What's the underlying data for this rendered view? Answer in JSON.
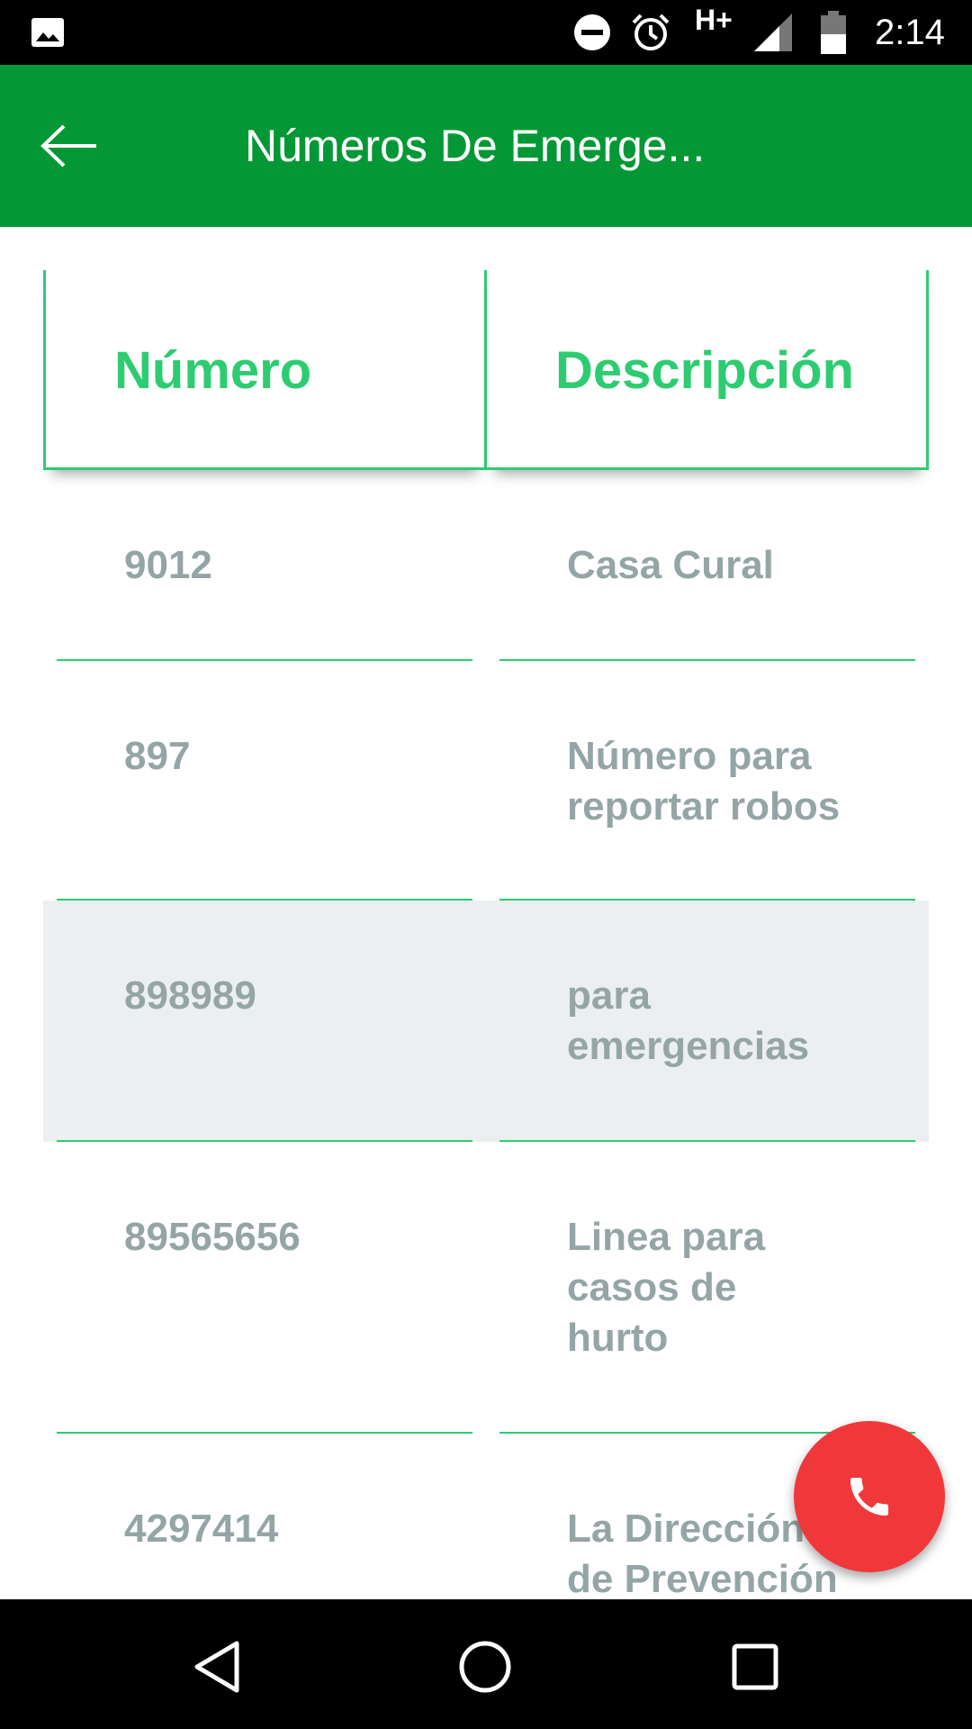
{
  "status_bar": {
    "time": "2:14",
    "network": "H+",
    "icons": [
      "gallery-icon",
      "do-not-disturb-icon",
      "alarm-icon",
      "signal-icon",
      "battery-icon"
    ]
  },
  "app_bar": {
    "title": "Números De Emerge...",
    "back_icon": "arrow-left-icon",
    "color": "#039835"
  },
  "table": {
    "headers": [
      "Número",
      "Descripción"
    ],
    "accent_color": "#2ecc71",
    "text_color": "#95a5a6",
    "rows": [
      {
        "numero": "9012",
        "descripcion": "Casa Cural"
      },
      {
        "numero": "897",
        "descripcion": "Número para reportar robos"
      },
      {
        "numero": "898989",
        "descripcion": "para emergencias",
        "highlighted": true
      },
      {
        "numero": "89565656",
        "descripcion": "Linea para casos de hurto"
      },
      {
        "numero": "4297414",
        "descripcion": "La Dirección de Prevención"
      }
    ]
  },
  "fab": {
    "icon": "phone-icon",
    "color": "#f0383a"
  },
  "nav_bar": {
    "icons": [
      "back-triangle-icon",
      "home-circle-icon",
      "recents-square-icon"
    ]
  }
}
